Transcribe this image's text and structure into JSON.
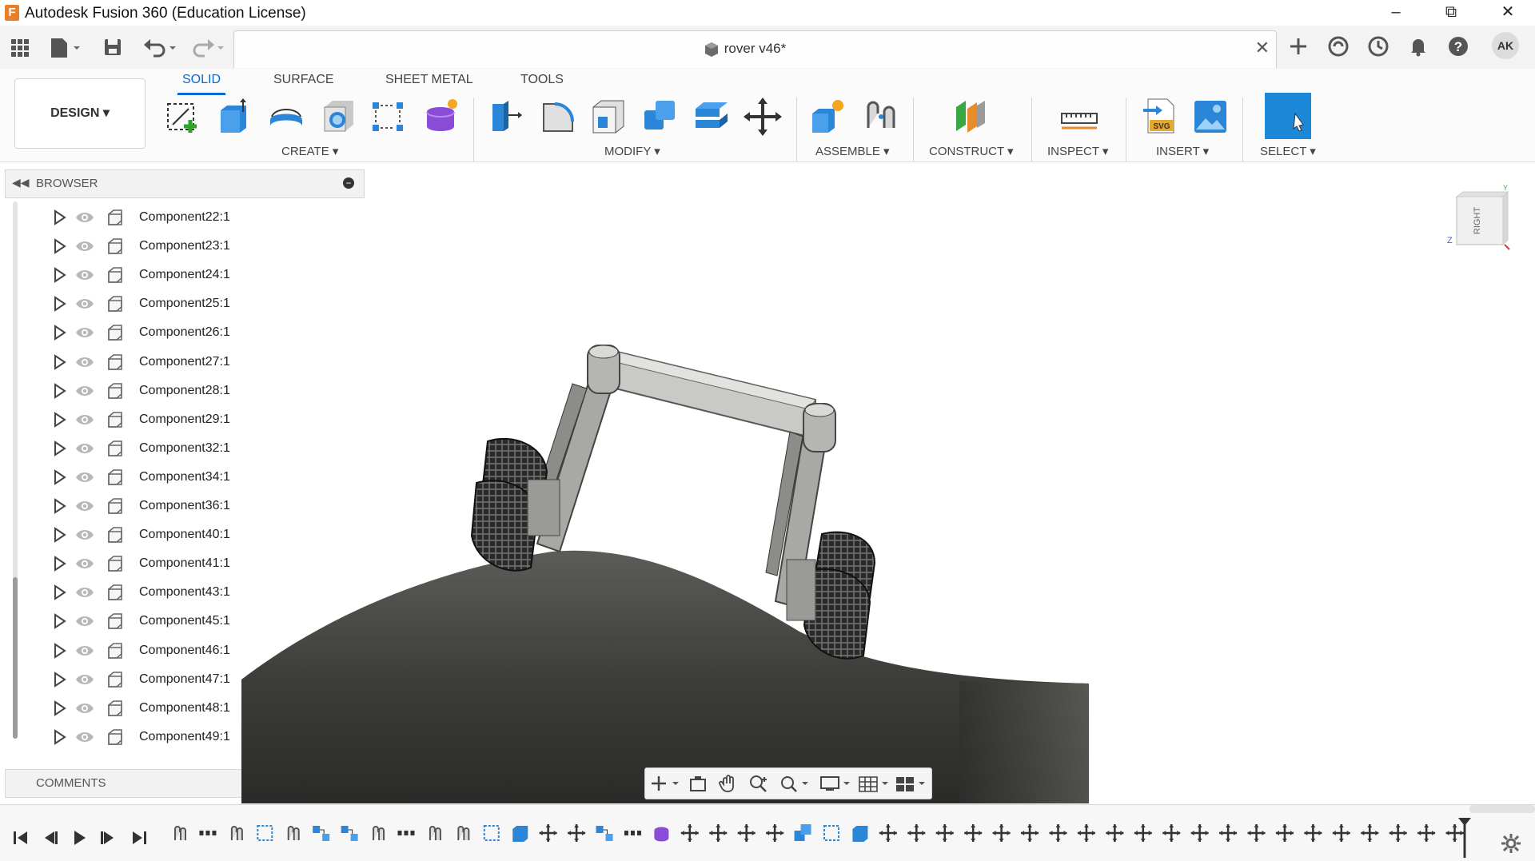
{
  "window": {
    "app_title": "Autodesk Fusion 360 (Education License)",
    "minimize": "–",
    "restore": "⧉",
    "close": "✕"
  },
  "document": {
    "title": "rover v46*",
    "close": "✕"
  },
  "user": {
    "initials": "AK"
  },
  "workspace": {
    "label": "DESIGN ▾"
  },
  "ribbon": {
    "tabs": [
      {
        "label": "SOLID",
        "active": true
      },
      {
        "label": "SURFACE",
        "active": false
      },
      {
        "label": "SHEET METAL",
        "active": false
      },
      {
        "label": "TOOLS",
        "active": false
      }
    ],
    "groups": {
      "create": "CREATE ▾",
      "modify": "MODIFY ▾",
      "assemble": "ASSEMBLE ▾",
      "construct": "CONSTRUCT ▾",
      "inspect": "INSPECT ▾",
      "insert": "INSERT ▾",
      "select": "SELECT ▾"
    }
  },
  "browser": {
    "title": "BROWSER",
    "items": [
      {
        "label": "Component22:1"
      },
      {
        "label": "Component23:1"
      },
      {
        "label": "Component24:1"
      },
      {
        "label": "Component25:1"
      },
      {
        "label": "Component26:1"
      },
      {
        "label": "Component27:1"
      },
      {
        "label": "Component28:1"
      },
      {
        "label": "Component29:1"
      },
      {
        "label": "Component32:1"
      },
      {
        "label": "Component34:1"
      },
      {
        "label": "Component36:1"
      },
      {
        "label": "Component40:1"
      },
      {
        "label": "Component41:1"
      },
      {
        "label": "Component43:1"
      },
      {
        "label": "Component45:1"
      },
      {
        "label": "Component46:1"
      },
      {
        "label": "Component47:1"
      },
      {
        "label": "Component48:1"
      },
      {
        "label": "Component49:1"
      }
    ]
  },
  "comments": {
    "title": "COMMENTS"
  },
  "viewcube": {
    "face": "RIGHT",
    "axis_y": "Y",
    "axis_z": "Z"
  },
  "colors": {
    "accent": "#0a6ad3",
    "select_tool": "#1e88d8",
    "terrain": "#4a4a47"
  }
}
